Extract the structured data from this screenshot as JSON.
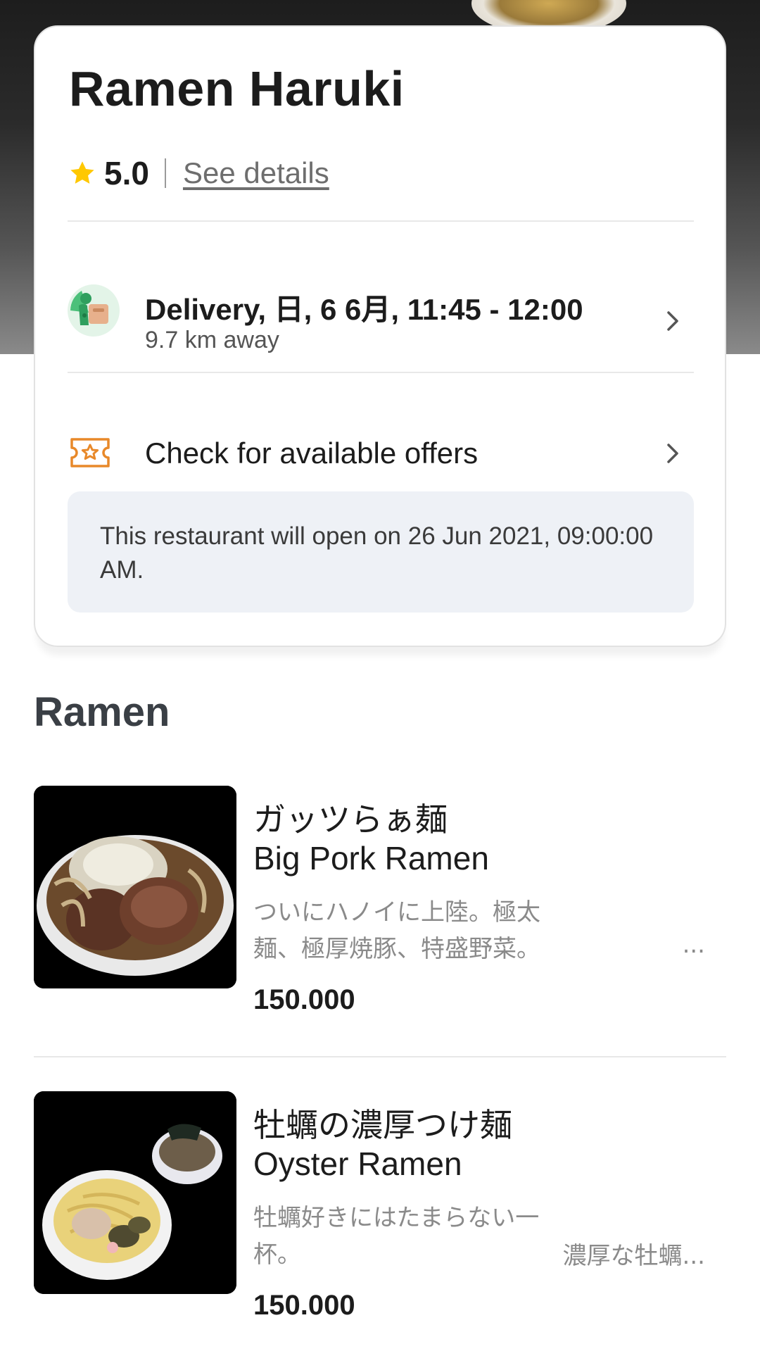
{
  "restaurant": {
    "name": "Ramen Haruki",
    "rating": "5.0",
    "details_link": "See details"
  },
  "delivery": {
    "title": "Delivery, 日, 6 6月, 11:45 - 12:00",
    "distance": "9.7 km away"
  },
  "offers": {
    "label": "Check for available offers"
  },
  "notice": {
    "text": "This restaurant will open on 26 Jun 2021, 09:00:00 AM."
  },
  "section": {
    "title": "Ramen"
  },
  "menu_items": [
    {
      "name_jp": "ガッツらぁ麺",
      "name_en": "Big Pork Ramen",
      "description": "ついにハノイに上陸。極太麺、極厚焼豚、特盛野菜。",
      "more": "...",
      "price": "150.000"
    },
    {
      "name_jp": "牡蠣の濃厚つけ麺",
      "name_en": "Oyster Ramen",
      "description": "牡蠣好きにはたまらない一杯。",
      "more": "濃厚な牡蠣...",
      "price": "150.000"
    }
  ],
  "icons": {
    "rating": "star-icon",
    "delivery": "courier-avatar-icon",
    "offers": "ticket-star-icon",
    "navigate": "chevron-right-icon"
  },
  "colors": {
    "star": "#FFC800",
    "offers_icon": "#E8892A",
    "notice_bg": "#EEF1F6",
    "courier_bg": "#4CC07A"
  }
}
